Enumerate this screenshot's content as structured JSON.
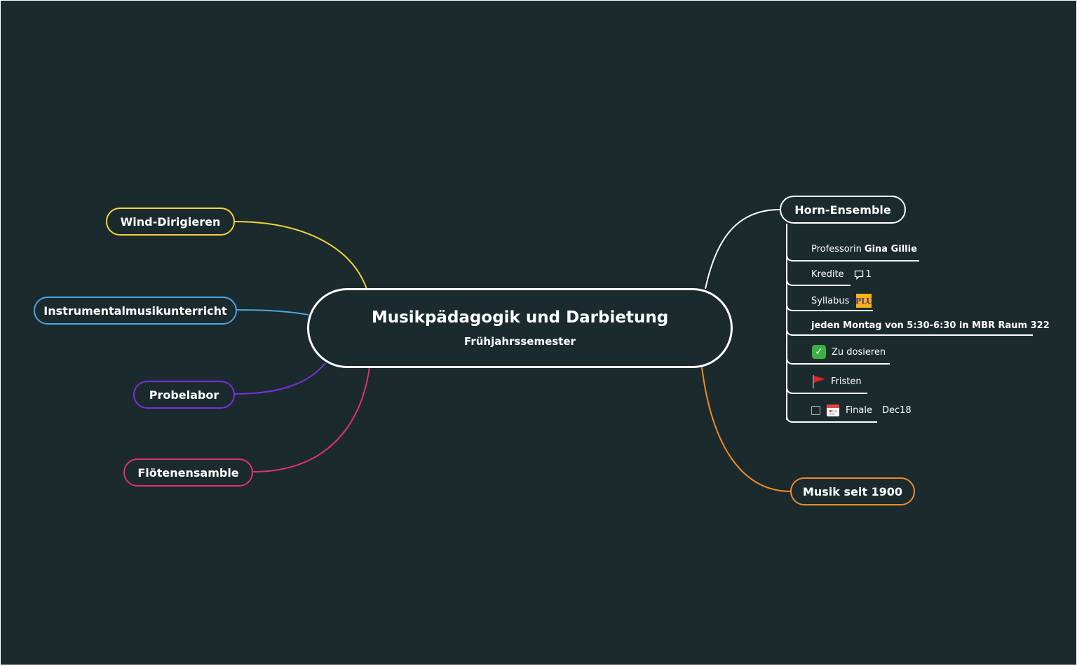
{
  "central": {
    "title": "Musikpädagogik und Darbietung",
    "subtitle": "Frühjahrssemester"
  },
  "left_topics": [
    {
      "label": "Wind-Dirigieren",
      "color": "#f5d43c"
    },
    {
      "label": "Instrumentalmusikunterricht",
      "color": "#4aa6e0"
    },
    {
      "label": "Probelabor",
      "color": "#7b2fe0"
    },
    {
      "label": "Flötenensamble",
      "color": "#e0336e"
    }
  ],
  "right_topics": [
    {
      "label": "Horn-Ensemble",
      "color": "#ffffff"
    },
    {
      "label": "Musik seit 1900",
      "color": "#f08a2a"
    }
  ],
  "horn_details": {
    "professor_prefix": "Professorin",
    "professor_name": "Gina Gillie",
    "credits_label": "Kredite",
    "comment_count": "1",
    "syllabus_label": "Syllabus",
    "syllabus_logo_text": "PLU",
    "schedule": "jeden Montag von 5:30-6:30 in MBR Raum 322",
    "todo_label": "Zu dosieren",
    "deadlines_label": "Fristen",
    "final_label": "Finale",
    "final_date": "Dec18"
  },
  "icons": {
    "todo": "check-mark-icon",
    "deadlines": "red-flag-icon",
    "final_checkbox": "checkbox-icon",
    "final_calendar": "calendar-icon",
    "credits": "comment-icon",
    "syllabus": "plu-logo-icon"
  },
  "colors": {
    "background": "#1b2a2d",
    "text": "#ffffff"
  }
}
